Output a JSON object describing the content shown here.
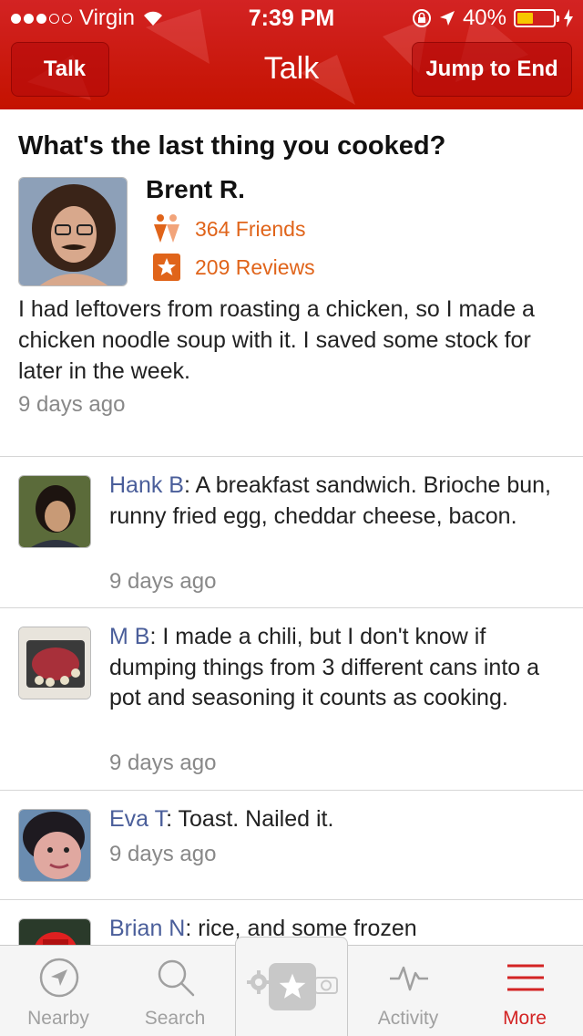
{
  "status_bar": {
    "carrier": "Virgin",
    "time": "7:39 PM",
    "battery": "40%"
  },
  "nav": {
    "back_label": "Talk",
    "title": "Talk",
    "right_button": "Jump to End"
  },
  "thread": {
    "question": "What's the last thing you cooked?",
    "author": "Brent R.",
    "friends": "364 Friends",
    "reviews": "209 Reviews",
    "body": "I had leftovers from roasting a chicken, so I made a chicken noodle soup with it.  I saved some stock for later in the week.",
    "time": "9 days ago"
  },
  "replies": [
    {
      "name": "Hank B",
      "text": ": A breakfast sandwich. Brioche bun, runny fried egg, cheddar cheese, bacon.",
      "time": "9 days ago"
    },
    {
      "name": "M B",
      "text": ": I made a chili, but I don't know if dumping things from 3 different cans into a pot and seasoning it counts as cooking.",
      "time": "9 days ago"
    },
    {
      "name": "Eva T",
      "text": ": Toast. Nailed it.",
      "time": "9 days ago"
    },
    {
      "name": "Brian N",
      "text": ": rice, and some frozen"
    }
  ],
  "tabbar": {
    "items": [
      {
        "label": "Nearby",
        "icon": "compass-icon"
      },
      {
        "label": "Search",
        "icon": "search-icon"
      },
      {
        "label": "",
        "icon": "review-star-icon"
      },
      {
        "label": "Activity",
        "icon": "activity-icon"
      },
      {
        "label": "More",
        "icon": "menu-icon",
        "active": true
      }
    ]
  },
  "colors": {
    "brand": "#d32323",
    "name_link": "#4a5e9a",
    "stat_orange": "#e0641a",
    "muted": "#888888"
  }
}
